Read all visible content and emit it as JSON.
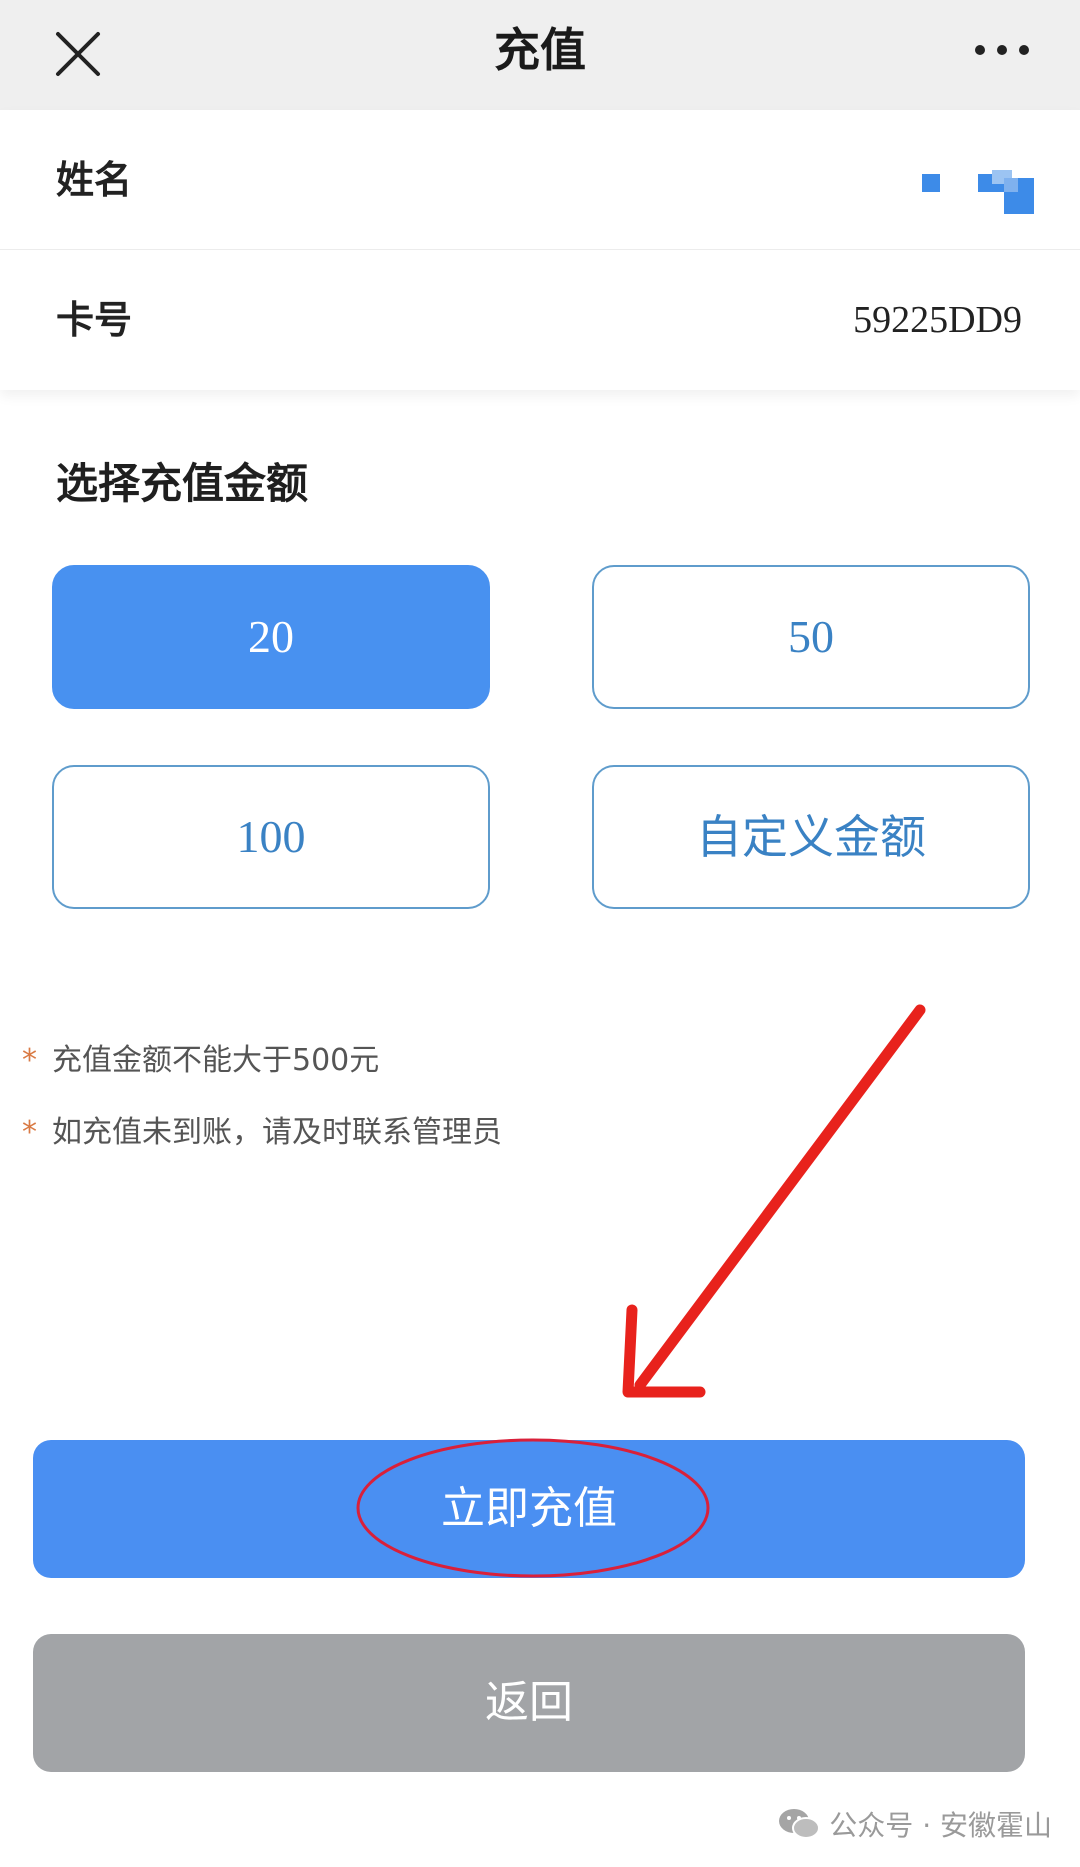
{
  "header": {
    "title": "充值",
    "close_icon": "close-icon",
    "more_icon": "more-horizontal-icon"
  },
  "info": {
    "name_label": "姓名",
    "card_label": "卡号",
    "card_value": "59225DD9"
  },
  "amount_section": {
    "title": "选择充值金额",
    "options": [
      {
        "label": "20",
        "selected": true
      },
      {
        "label": "50",
        "selected": false
      },
      {
        "label": "100",
        "selected": false
      },
      {
        "label": "自定义金额",
        "selected": false
      }
    ]
  },
  "notes": [
    {
      "star": "*",
      "text": "充值金额不能大于500元"
    },
    {
      "star": "*",
      "text": "如充值未到账，请及时联系管理员"
    }
  ],
  "actions": {
    "recharge_label": "立即充值",
    "back_label": "返回"
  },
  "watermark": {
    "text": "公众号 · 安徽霍山"
  },
  "colors": {
    "accent_blue": "#4a8ff2",
    "option_border": "#5f9ccc",
    "option_text": "#3a82c4",
    "back_gray": "#a2a4a7",
    "annotation_red": "#e8221c",
    "note_star": "#d97a44"
  }
}
